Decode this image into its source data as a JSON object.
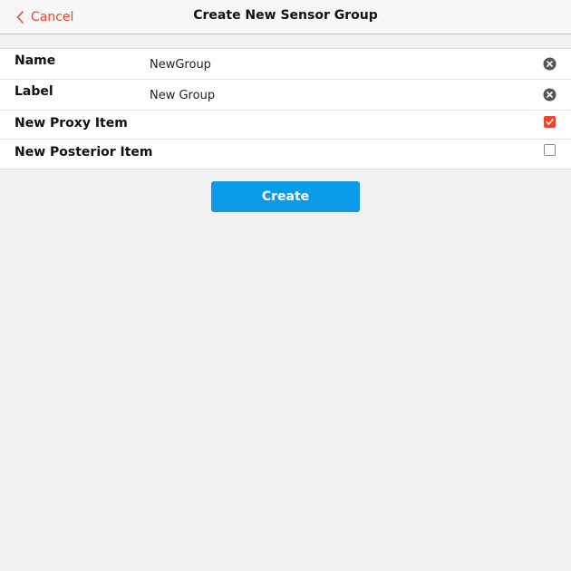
{
  "navbar": {
    "cancel_label": "Cancel",
    "title": "Create New Sensor Group",
    "accent_color": "#e8492f"
  },
  "form": {
    "name": {
      "label": "Name",
      "value": "NewGroup",
      "clear_icon": "clear-circle-icon"
    },
    "label_field": {
      "label": "Label",
      "value": "New Group",
      "clear_icon": "clear-circle-icon"
    },
    "proxy_item": {
      "label": "New Proxy Item",
      "checked": true
    },
    "posterior_item": {
      "label": "New Posterior Item",
      "checked": false
    }
  },
  "actions": {
    "create_label": "Create",
    "create_color": "#0b9be8"
  }
}
